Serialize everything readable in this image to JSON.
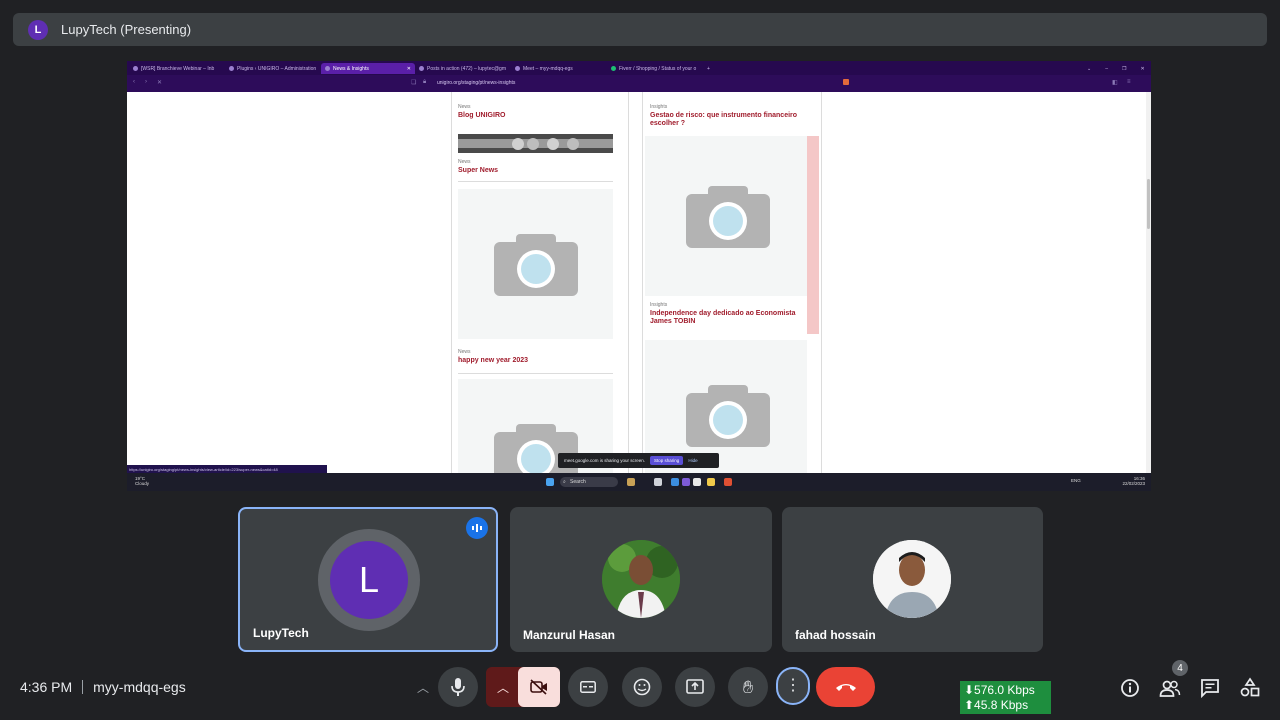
{
  "presenter": {
    "initial": "L",
    "label": "LupyTech (Presenting)"
  },
  "browser": {
    "tabs": [
      {
        "label": "[WSR] Branchieve Webinar – Inb"
      },
      {
        "label": "Plugins ‹ UNIGIRO – Administration"
      },
      {
        "label": "News & Insights",
        "active": true
      },
      {
        "label": "Posts in action (472) – lupytec@gm"
      },
      {
        "label": "Meet – myy-mdqq-egs"
      },
      {
        "label": "Fiverr / Shopping / Status of your o"
      }
    ],
    "url": "unigiro.org/staging/pt/news-insights",
    "status_url": "https://unigiro.org/staging/pt/news-insights/view-article/id=223/super-news&catid=48"
  },
  "page": {
    "left_column": [
      {
        "category": "News",
        "title": "Blog UNIGIRO"
      },
      {
        "category": "News",
        "title": "Super News"
      },
      {
        "category": "News",
        "title": "happy new year 2023"
      }
    ],
    "right_column": [
      {
        "category": "Insights",
        "title": "Gestao de risco: que instrumento financeiro escolher ?"
      },
      {
        "category": "Insights",
        "title": "Independence day dedicado ao Economista James TOBIN"
      }
    ]
  },
  "share_notice": {
    "text": "meet.google.com is sharing your screen.",
    "stop_label": "Stop sharing",
    "hide_label": "Hide"
  },
  "taskbar": {
    "weather_temp": "19°C",
    "weather_desc": "Cloudy",
    "search_label": "Search",
    "lang": "ENG",
    "time": "16:36",
    "date": "22/02/2023"
  },
  "participants": [
    {
      "name": "LupyTech",
      "initial": "L",
      "speaking": true
    },
    {
      "name": "Manzurul Hasan"
    },
    {
      "name": "fahad hossain"
    }
  ],
  "bottom": {
    "time": "4:36 PM",
    "meeting_code": "myy-mdqq-egs",
    "download": "⬇576.0 Kbps",
    "upload": "⬆45.8 Kbps",
    "people_count": "4"
  },
  "colors": {
    "accent_purple": "#5f2eb3",
    "end_call_red": "#ea4335",
    "camera_off_bg": "#f9dedc",
    "link_red": "#a01c2c"
  }
}
